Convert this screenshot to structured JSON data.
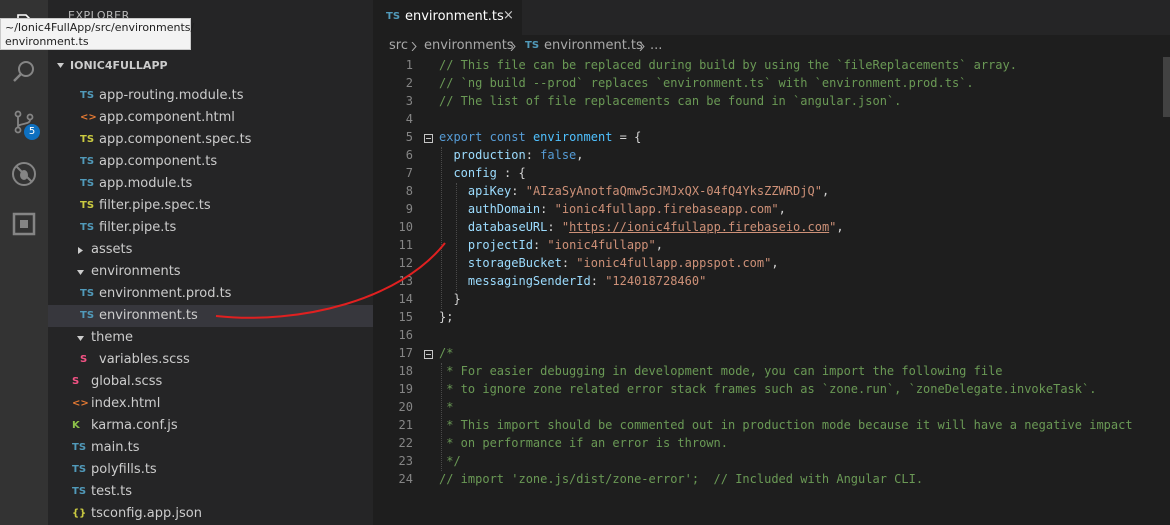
{
  "explorer": {
    "title": "EXPLORER",
    "tooltip": "~/Ionic4FullApp/src/environments/\nenvironment.ts",
    "project": "IONIC4FULLAPP",
    "badge_count": "5",
    "files": [
      {
        "label": "app-routing.module.ts",
        "icon": "TS",
        "icon_color": "#519aba"
      },
      {
        "label": "app.component.html",
        "icon": "<>",
        "icon_color": "#e37933"
      },
      {
        "label": "app.component.spec.ts",
        "icon": "TS",
        "icon_color": "#cbcb41"
      },
      {
        "label": "app.component.ts",
        "icon": "TS",
        "icon_color": "#519aba"
      },
      {
        "label": "app.module.ts",
        "icon": "TS",
        "icon_color": "#519aba"
      },
      {
        "label": "filter.pipe.spec.ts",
        "icon": "TS",
        "icon_color": "#cbcb41"
      },
      {
        "label": "filter.pipe.ts",
        "icon": "TS",
        "icon_color": "#519aba"
      },
      {
        "label": "assets",
        "icon": "",
        "icon_color": ""
      },
      {
        "label": "environments",
        "icon": "",
        "icon_color": ""
      },
      {
        "label": "environment.prod.ts",
        "icon": "TS",
        "icon_color": "#519aba"
      },
      {
        "label": "environment.ts",
        "icon": "TS",
        "icon_color": "#519aba"
      },
      {
        "label": "theme",
        "icon": "",
        "icon_color": ""
      },
      {
        "label": "variables.scss",
        "icon": "S",
        "icon_color": "#f55385"
      },
      {
        "label": "global.scss",
        "icon": "S",
        "icon_color": "#f55385"
      },
      {
        "label": "index.html",
        "icon": "<>",
        "icon_color": "#e37933"
      },
      {
        "label": "karma.conf.js",
        "icon": "K",
        "icon_color": "#8dc149"
      },
      {
        "label": "main.ts",
        "icon": "TS",
        "icon_color": "#519aba"
      },
      {
        "label": "polyfills.ts",
        "icon": "TS",
        "icon_color": "#519aba"
      },
      {
        "label": "test.ts",
        "icon": "TS",
        "icon_color": "#519aba"
      },
      {
        "label": "tsconfig.app.json",
        "icon": "{}",
        "icon_color": "#cbcb41"
      }
    ]
  },
  "tab": {
    "icon": "TS",
    "label": "environment.ts",
    "close": "×"
  },
  "breadcrumb": {
    "part1": "src",
    "part2": "environments",
    "part3_icon": "TS",
    "part3": "environment.ts",
    "more": "..."
  },
  "editor": {
    "lines": [
      {
        "n": "1",
        "html": "<span class='c-com'>// This file can be replaced during build by using the `fileReplacements` array.</span>"
      },
      {
        "n": "2",
        "html": "<span class='c-com'>// `ng build --prod` replaces `environment.ts` with `environment.prod.ts`.</span>"
      },
      {
        "n": "3",
        "html": "<span class='c-com'>// The list of file replacements can be found in `angular.json`.</span>"
      },
      {
        "n": "4",
        "html": ""
      },
      {
        "n": "5",
        "html": "<span class='c-kw'>export</span> <span class='c-kw'>const</span> <span class='c-var'>environment</span> = {"
      },
      {
        "n": "6",
        "html": "  <span class='c-prop'>production</span>: <span class='c-kw'>false</span>,"
      },
      {
        "n": "7",
        "html": "  <span class='c-prop'>config</span> : {"
      },
      {
        "n": "8",
        "html": "    <span class='c-prop'>apiKey</span>: <span class='c-str'>\"AIzaSyAnotfaQmw5cJMJxQX-04fQ4YksZZWRDjQ\"</span>,"
      },
      {
        "n": "9",
        "html": "    <span class='c-prop'>authDomain</span>: <span class='c-str'>\"ionic4fullapp.firebaseapp.com\"</span>,"
      },
      {
        "n": "10",
        "html": "    <span class='c-prop'>databaseURL</span>: <span class='c-str'>\"</span><span class='c-url'>https://ionic4fullapp.firebaseio.com</span><span class='c-str'>\"</span>,"
      },
      {
        "n": "11",
        "html": "    <span class='c-prop'>projectId</span>: <span class='c-str'>\"ionic4fullapp\"</span>,"
      },
      {
        "n": "12",
        "html": "    <span class='c-prop'>storageBucket</span>: <span class='c-str'>\"ionic4fullapp.appspot.com\"</span>,"
      },
      {
        "n": "13",
        "html": "    <span class='c-prop'>messagingSenderId</span>: <span class='c-str'>\"124018728460\"</span>"
      },
      {
        "n": "14",
        "html": "  }"
      },
      {
        "n": "15",
        "html": "};"
      },
      {
        "n": "16",
        "html": ""
      },
      {
        "n": "17",
        "html": "<span class='c-com'>/*</span>"
      },
      {
        "n": "18",
        "html": "<span class='c-com'> * For easier debugging in development mode, you can import the following file</span>"
      },
      {
        "n": "19",
        "html": "<span class='c-com'> * to ignore zone related error stack frames such as `zone.run`, `zoneDelegate.invokeTask`.</span>"
      },
      {
        "n": "20",
        "html": "<span class='c-com'> *</span>"
      },
      {
        "n": "21",
        "html": "<span class='c-com'> * This import should be commented out in production mode because it will have a negative impact</span>"
      },
      {
        "n": "22",
        "html": "<span class='c-com'> * on performance if an error is thrown.</span>"
      },
      {
        "n": "23",
        "html": "<span class='c-com'> */</span>"
      },
      {
        "n": "24",
        "html": "<span class='c-com'>// import 'zone.js/dist/zone-error';  // Included with Angular CLI.</span>"
      }
    ]
  }
}
